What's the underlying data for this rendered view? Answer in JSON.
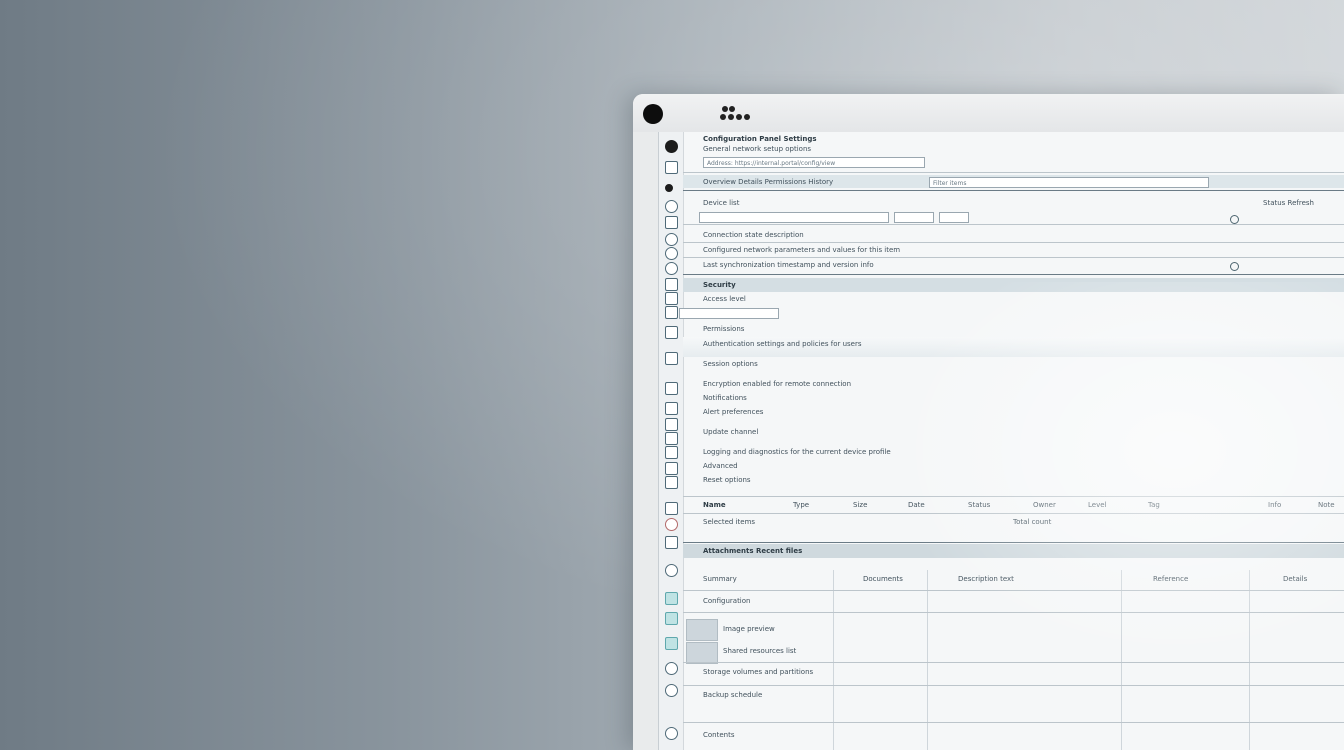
{
  "window": {
    "toolbar": {
      "title": "Configuration Panel Settings",
      "subtitle": "General network setup options",
      "address": "Address: https://internal.portal/config/view"
    },
    "tab_row": {
      "label": "Overview  Details  Permissions  History",
      "field": "Filter items"
    },
    "filter": {
      "label": "Device list",
      "combo_1": "",
      "combo_2": "",
      "right": "Status  Refresh"
    },
    "rows_top": [
      "Connection state description",
      "Configured network parameters and values for this item",
      "Last synchronization timestamp and version info"
    ],
    "section_1": {
      "header": "Security",
      "items": [
        "Access level",
        "Permissions",
        "Authentication settings and policies for users",
        "Session options",
        "Encryption enabled for remote connection",
        "Notifications",
        "Alert preferences",
        "Update channel",
        "Logging and diagnostics for the current device profile",
        "Advanced",
        "Reset options"
      ]
    },
    "columns": [
      "Name",
      "Type",
      "Size",
      "Date",
      "Status",
      "Owner",
      "Level",
      "Tag",
      "Info",
      "Note"
    ],
    "summary_row": {
      "left": "Selected items",
      "right": "Total count"
    },
    "section_2": {
      "header": "Attachments  Recent files",
      "rows": [
        {
          "name": "Summary",
          "col2": "Documents",
          "col3": "Description text",
          "col4": "Reference",
          "col5": "Details"
        },
        {
          "name": "Configuration",
          "col2": "",
          "col3": "",
          "col4": "",
          "col5": ""
        },
        {
          "name": "Image preview",
          "col2": "",
          "col3": "",
          "col4": "",
          "col5": ""
        },
        {
          "name": "Shared resources list",
          "col2": "",
          "col3": "",
          "col4": "",
          "col5": ""
        },
        {
          "name": "Storage volumes and partitions",
          "col2": "",
          "col3": "",
          "col4": "",
          "col5": ""
        },
        {
          "name": "Backup schedule",
          "col2": "",
          "col3": "",
          "col4": "",
          "col5": ""
        }
      ],
      "footer": "Contents"
    }
  }
}
